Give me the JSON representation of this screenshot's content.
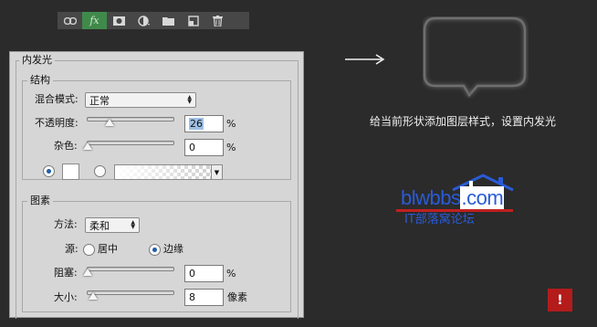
{
  "toolbar": {
    "buttons": [
      {
        "name": "link-icon"
      },
      {
        "name": "fx-icon",
        "label": "fx"
      },
      {
        "name": "mask-icon"
      },
      {
        "name": "adjustment-layer-icon"
      },
      {
        "name": "folder-icon"
      },
      {
        "name": "new-layer-icon"
      },
      {
        "name": "trash-icon"
      }
    ]
  },
  "dialog": {
    "title": "内发光",
    "structure": {
      "title": "结构",
      "blend_mode_label": "混合模式:",
      "blend_mode_value": "正常",
      "opacity_label": "不透明度:",
      "opacity_value": "26",
      "opacity_unit": "%",
      "noise_label": "杂色:",
      "noise_value": "0",
      "noise_unit": "%",
      "opacity_slider_level": 0.26,
      "noise_slider_level": 0,
      "color_radio_selected": true,
      "gradient_radio_selected": false
    },
    "elements": {
      "title": "图素",
      "method_label": "方法:",
      "method_value": "柔和",
      "source_label": "源:",
      "source_center_label": "居中",
      "source_edge_label": "边缘",
      "source_selected": "边缘",
      "choke_label": "阻塞:",
      "choke_value": "0",
      "choke_unit": "%",
      "size_label": "大小:",
      "size_value": "8",
      "size_unit": "像素",
      "choke_slider_level": 0,
      "size_slider_level": 0.03
    }
  },
  "caption": "给当前形状添加图层样式，设置内发光",
  "logo": {
    "text_main": "blwbbs",
    "text_com": ".com",
    "subtitle": "IT部落窝论坛"
  },
  "badge": {
    "text": "!"
  },
  "colors": {
    "background": "#2b2b2b",
    "panel": "#d6d6d6",
    "fx_active": "#3f8a4a",
    "logo_blue": "#2a5bd6",
    "logo_red": "#c02020",
    "badge_red": "#b41c1c"
  }
}
